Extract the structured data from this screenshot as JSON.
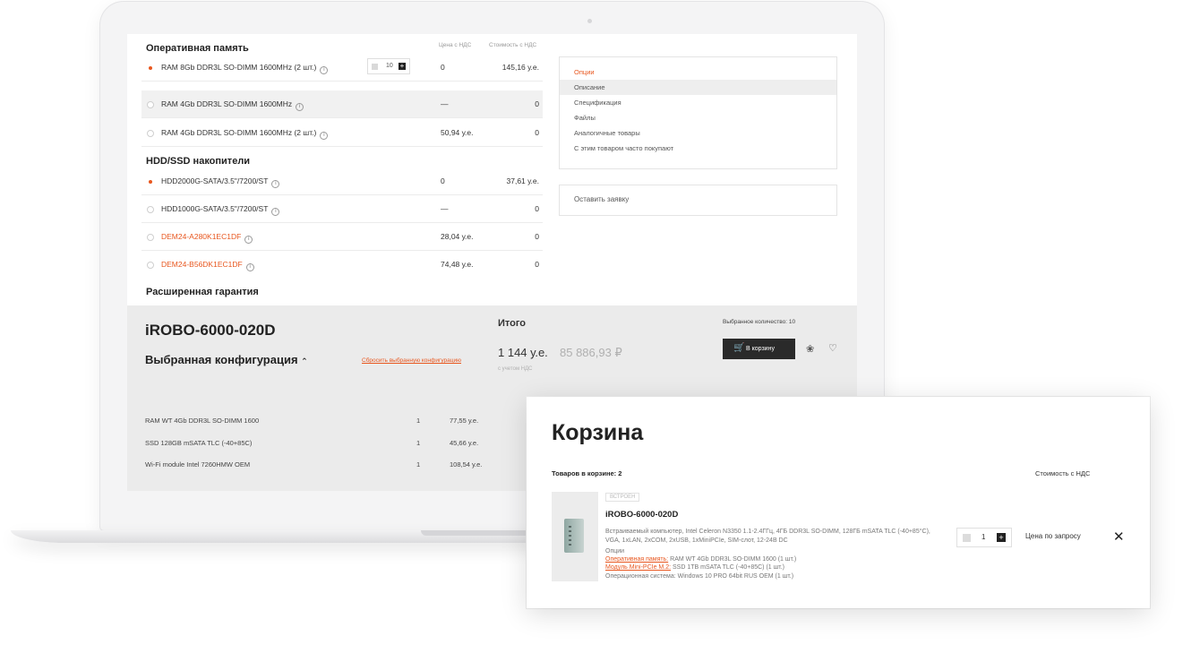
{
  "options": {
    "ram": {
      "title": "Оперативная память",
      "col_price": "Цена с НДС",
      "col_cost": "Стоимость с НДС",
      "rows": [
        {
          "name": "RAM 8Gb DDR3L SO-DIMM 1600MHz (2 шт.)",
          "qty": "10",
          "price": "0",
          "cost": "145,16 у.е.",
          "selected": true
        },
        {
          "name": "RAM 4Gb DDR3L SO-DIMM 1600MHz",
          "price": "—",
          "cost": "0",
          "selected": false
        },
        {
          "name": "RAM 4Gb DDR3L SO-DIMM 1600MHz (2 шт.)",
          "price": "50,94 у.е.",
          "cost": "0",
          "selected": false
        }
      ]
    },
    "storage": {
      "title": "HDD/SSD накопители",
      "rows": [
        {
          "name": "HDD2000G-SATA/3.5\"/7200/ST",
          "price": "0",
          "cost": "37,61 у.е.",
          "selected": true
        },
        {
          "name": "HDD1000G-SATA/3.5\"/7200/ST",
          "price": "—",
          "cost": "0",
          "selected": false
        },
        {
          "name": "DEM24-A280K1EC1DF",
          "price": "28,04 у.е.",
          "cost": "0",
          "selected": false
        },
        {
          "name": "DEM24-B56DK1EC1DF",
          "price": "74,48 у.е.",
          "cost": "0",
          "selected": false
        }
      ]
    },
    "warranty_title": "Расширенная гарантия"
  },
  "menu": {
    "items": [
      "Опции",
      "Описание",
      "Спецификация",
      "Файлы",
      "Аналогичные товары",
      "С этим товаром часто покупают"
    ],
    "request": "Оставить заявку"
  },
  "summary": {
    "model": "iROBO-6000-020D",
    "config_title": "Выбранная конфигурация",
    "reset": "Сбросить выбранную конфигурацию",
    "total_title": "Итого",
    "total": "1 144 у.е.",
    "total_rub": "85 886,93 ₽",
    "vat_note": "с учетом НДС",
    "qty_label": "Выбранное количество: 10",
    "cart_button": "В корзину",
    "rows": [
      {
        "name": "RAM WT 4Gb DDR3L SO-DIMM 1600",
        "qty": "1",
        "price": "77,55 у.е."
      },
      {
        "name": "SSD 128GB mSATA TLC (-40+85C)",
        "qty": "1",
        "price": "45,66 у.е."
      },
      {
        "name": "Wi-Fi module Intel 7260HMW OEM",
        "qty": "1",
        "price": "108,54 у.е."
      }
    ]
  },
  "cart": {
    "title": "Корзина",
    "count_label": "Товаров в корзине: 2",
    "col_cost": "Стоимость с НДС",
    "item": {
      "badge": "ВСТРОЕН",
      "name": "iROBO-6000-020D",
      "desc": "Встраиваемый компьютер, Intel Celeron N3350 1.1-2.4ГГц, 4ГБ DDR3L SO-DIMM, 128ГБ mSATA TLC (-40+85°C), VGA, 1xLAN, 2xCOM, 2xUSB, 1xMiniPCIe, SIM-слот, 12-24В DC",
      "options_label": "Опции",
      "opt1_key": "Оперативная память:",
      "opt1_val": " RAM WT 4Gb DDR3L SO-DIMM 1600 (1 шт.)",
      "opt2_key": "Модуль Mini-PCIe M.2:",
      "opt2_val": " SSD 1TB mSATA TLC (-40+85C) (1 шт.)",
      "opt3": "Операционная система: Windows 10 PRO 64bit RUS OEM (1 шт.)",
      "qty": "1",
      "price": "Цена по запросу"
    }
  },
  "colors": {
    "accent": "#e8571f",
    "dark": "#2a2a2a",
    "panel": "#ebebeb"
  }
}
